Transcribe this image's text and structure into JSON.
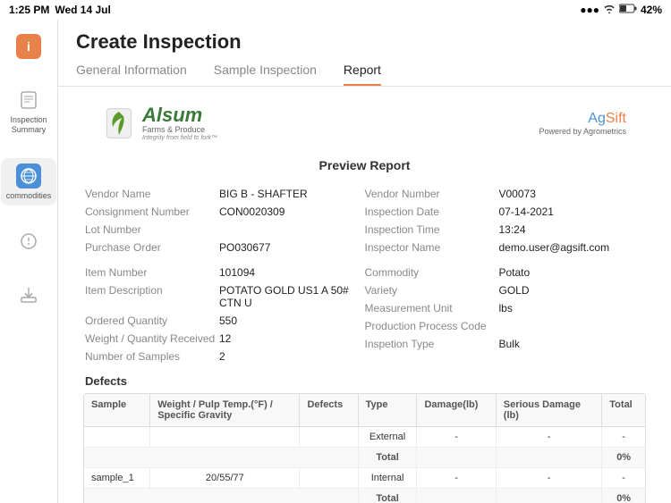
{
  "statusBar": {
    "time": "1:25 PM",
    "date": "Wed 14 Jul",
    "battery": "42%",
    "signal": "●●●"
  },
  "sidebar": {
    "items": [
      {
        "id": "info-icon",
        "label": "i",
        "type": "orange",
        "active": false
      },
      {
        "id": "inspection-summary",
        "label": "Inspection\nSummary",
        "active": false
      },
      {
        "id": "commodities",
        "label": "Commodities",
        "active": true
      },
      {
        "id": "detail-icon",
        "label": "",
        "active": false
      },
      {
        "id": "export-icon",
        "label": "",
        "active": false
      }
    ]
  },
  "header": {
    "title": "Create Inspection",
    "tabs": [
      {
        "id": "general-information",
        "label": "General Information",
        "active": false
      },
      {
        "id": "sample-inspection",
        "label": "Sample Inspection",
        "active": false
      },
      {
        "id": "report",
        "label": "Report",
        "active": true
      }
    ]
  },
  "report": {
    "preview_title": "Preview Report",
    "alsum": {
      "name": "Alsum",
      "sub": "Farms & Produce",
      "tagline": "Integrity from field to fork™"
    },
    "agsift": {
      "ag": "Ag",
      "sift": "Sift",
      "powered": "Powered by Agrometrics"
    },
    "fields_left": [
      {
        "label": "Vendor Name",
        "value": "BIG B - SHAFTER"
      },
      {
        "label": "Consignment Number",
        "value": "CON0020309"
      },
      {
        "label": "Lot Number",
        "value": ""
      },
      {
        "label": "Purchase Order",
        "value": "PO030677"
      },
      {
        "label": "",
        "value": ""
      },
      {
        "label": "Item Number",
        "value": "101094"
      },
      {
        "label": "Item Description",
        "value": "POTATO GOLD US1 A 50# CTN U"
      },
      {
        "label": "Ordered Quantity",
        "value": "550"
      },
      {
        "label": "Weight / Quantity Received",
        "value": "12"
      },
      {
        "label": "Number of Samples",
        "value": "2"
      }
    ],
    "fields_right": [
      {
        "label": "Vendor Number",
        "value": "V00073"
      },
      {
        "label": "Inspection Date",
        "value": "07-14-2021"
      },
      {
        "label": "Inspection Time",
        "value": "13:24"
      },
      {
        "label": "Inspector Name",
        "value": "demo.user@agsift.com"
      },
      {
        "label": "",
        "value": ""
      },
      {
        "label": "Commodity",
        "value": "Potato"
      },
      {
        "label": "Variety",
        "value": "GOLD"
      },
      {
        "label": "Measurement Unit",
        "value": "lbs"
      },
      {
        "label": "Production Process Code",
        "value": ""
      },
      {
        "label": "Inspetion Type",
        "value": "Bulk"
      }
    ],
    "defects_title": "Defects",
    "defects_table": {
      "headers": [
        "Sample",
        "Weight / Pulp Temp.(°F) /\nSpecific Gravity",
        "Defects",
        "Type",
        "Damage(lb)",
        "Serious Damage\n(lb)",
        "Total"
      ],
      "rows": [
        {
          "sample": "",
          "weight": "",
          "defects": "",
          "type": "External",
          "damage": "-",
          "serious": "-",
          "total": "-"
        },
        {
          "sample": "",
          "weight": "",
          "defects": "",
          "type": "Total",
          "damage": "",
          "serious": "",
          "total": "0%",
          "is_total": true
        },
        {
          "sample": "sample_1",
          "weight": "20/55/77",
          "defects": "",
          "type": "Internal",
          "damage": "-",
          "serious": "-",
          "total": "-"
        },
        {
          "sample": "",
          "weight": "",
          "defects": "",
          "type": "Total",
          "damage": "",
          "serious": "",
          "total": "0%",
          "is_total": true
        }
      ]
    }
  }
}
